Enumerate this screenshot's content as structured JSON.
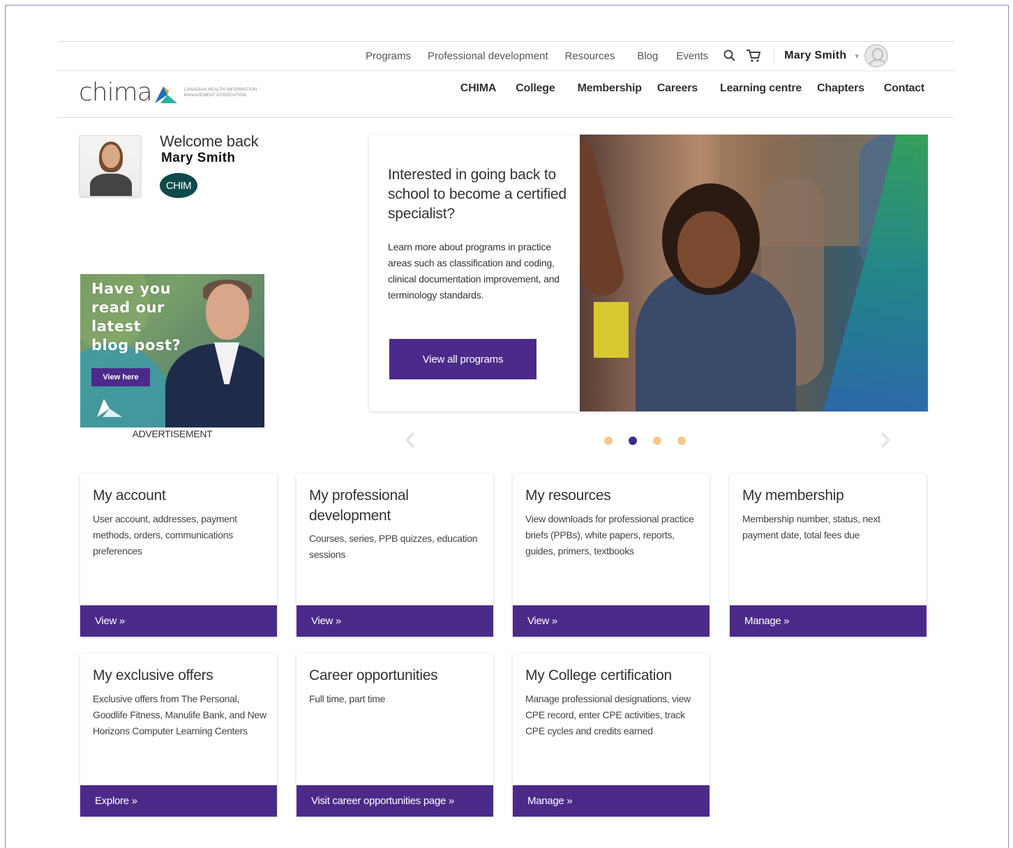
{
  "utility_nav": {
    "links": [
      "Programs",
      "Professional development",
      "Resources",
      "Blog",
      "Events"
    ],
    "user_name": "Mary Smith"
  },
  "brand": {
    "logo_word": "chima",
    "logo_subtitle": "CANADIAN HEALTH INFORMATION MANAGEMENT ASSOCIATION"
  },
  "main_nav": [
    "CHIMA",
    "College",
    "Membership",
    "Careers",
    "Learning centre",
    "Chapters",
    "Contact"
  ],
  "welcome": {
    "greeting": "Welcome back",
    "name": "Mary Smith",
    "badge": "CHIM"
  },
  "ad": {
    "headline": "Have you read our latest blog post?",
    "button": "View here",
    "label": "ADVERTISEMENT"
  },
  "hero": {
    "title": "Interested in going back to school to become a certified specialist?",
    "body": "Learn more about programs in practice areas such as classification and coding, clinical documentation improvement, and terminology standards.",
    "button": "View all programs",
    "slides_total": 4,
    "active_slide": 2
  },
  "colors": {
    "primary_purple": "#4b2a8a",
    "dot_inactive": "#f5c98a",
    "dot_active": "#3d2a8a",
    "badge_teal": "#0e4a4a"
  },
  "cards": [
    {
      "title": "My account",
      "desc": "User account, addresses, payment methods, orders, communications preferences",
      "button": "View »"
    },
    {
      "title": "My professional development",
      "desc": "Courses, series, PPB quizzes, education sessions",
      "button": "View »"
    },
    {
      "title": "My resources",
      "desc": "View downloads for professional practice briefs (PPBs), white papers, reports, guides, primers, textbooks",
      "button": "View »"
    },
    {
      "title": "My membership",
      "desc": "Membership number, status, next payment date, total fees due",
      "button": "Manage »"
    },
    {
      "title": "My exclusive offers",
      "desc": "Exclusive offers from The Personal, Goodlife Fitness, Manulife Bank, and New Horizons Computer Learning Centers",
      "button": "Explore »"
    },
    {
      "title": "Career opportunities",
      "desc": "Full time, part time",
      "button": "Visit career opportunities page »"
    },
    {
      "title": "My College certification",
      "desc": "Manage professional designations, view CPE record, enter CPE activities, track CPE cycles and credits earned",
      "button": "Manage »"
    }
  ]
}
